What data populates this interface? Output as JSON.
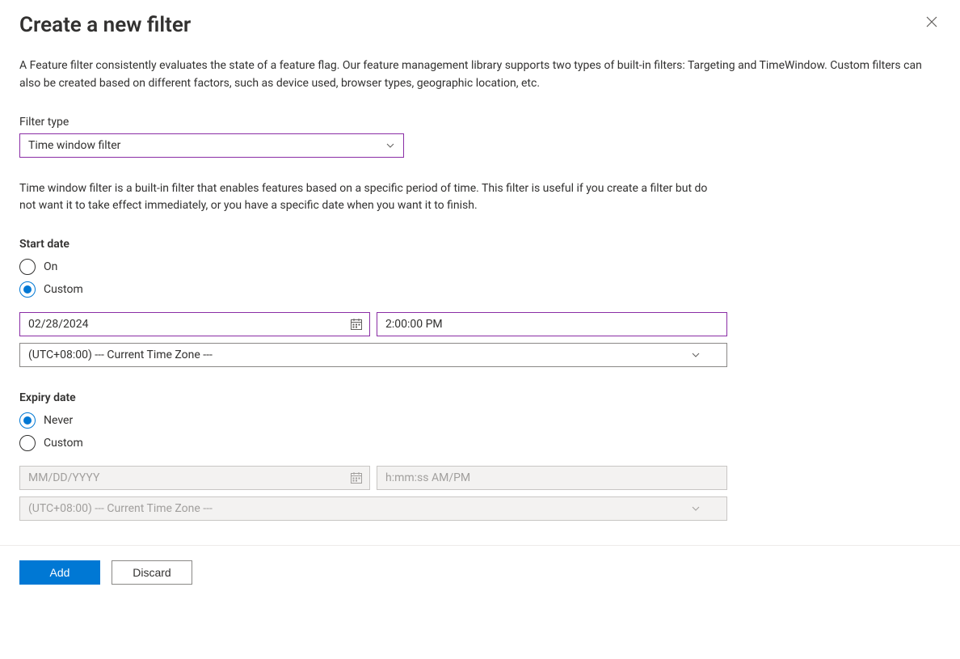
{
  "header": {
    "title": "Create a new filter"
  },
  "description": "A Feature filter consistently evaluates the state of a feature flag. Our feature management library supports two types of built-in filters: Targeting and TimeWindow. Custom filters can also be created based on different factors, such as device used, browser types, geographic location, etc.",
  "filter_type": {
    "label": "Filter type",
    "selected": "Time window filter",
    "description": "Time window filter is a built-in filter that enables features based on a specific period of time. This filter is useful if you create a filter but do not want it to take effect immediately, or you have a specific date when you want it to finish."
  },
  "start_date": {
    "label": "Start date",
    "options": {
      "on": "On",
      "custom": "Custom"
    },
    "selected": "custom",
    "date_value": "02/28/2024",
    "time_value": "2:00:00 PM",
    "timezone": "(UTC+08:00) --- Current Time Zone ---"
  },
  "expiry_date": {
    "label": "Expiry date",
    "options": {
      "never": "Never",
      "custom": "Custom"
    },
    "selected": "never",
    "date_placeholder": "MM/DD/YYYY",
    "time_placeholder": "h:mm:ss AM/PM",
    "timezone": "(UTC+08:00) --- Current Time Zone ---"
  },
  "footer": {
    "add": "Add",
    "discard": "Discard"
  }
}
